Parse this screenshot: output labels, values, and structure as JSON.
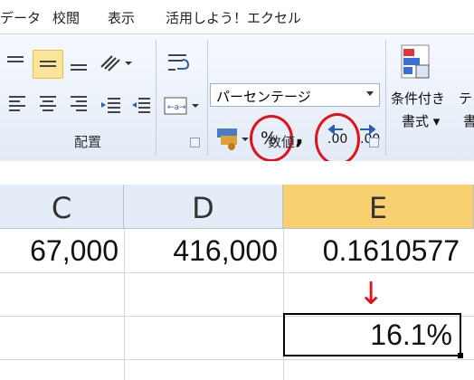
{
  "tabs": [
    "データ",
    "校閲",
    "表示",
    "活用しよう！エクセル"
  ],
  "ribbon": {
    "alignment_group_label": "配置",
    "number_group_label": "数値",
    "number_format_value": "パーセンテージ",
    "percent_button_label": "%",
    "comma_button_label": ",",
    "increase_decimal_label": ".00",
    "decrease_decimal_label": ".00",
    "conditional_format_label": "条件付き",
    "conditional_format_sub": "書式 ▾",
    "table_label": "テ",
    "table_sub": "書"
  },
  "sheet": {
    "columns": [
      "C",
      "D",
      "E"
    ],
    "selected_column": "E",
    "rows": [
      [
        "67,000",
        "416,000",
        "0.1610577"
      ],
      [
        "",
        "",
        "↓"
      ],
      [
        "",
        "",
        "16.1%"
      ]
    ]
  },
  "colors": {
    "highlight_circle": "#e0121a",
    "arrow": "#e0121a",
    "selected_header": "#f8d070"
  }
}
